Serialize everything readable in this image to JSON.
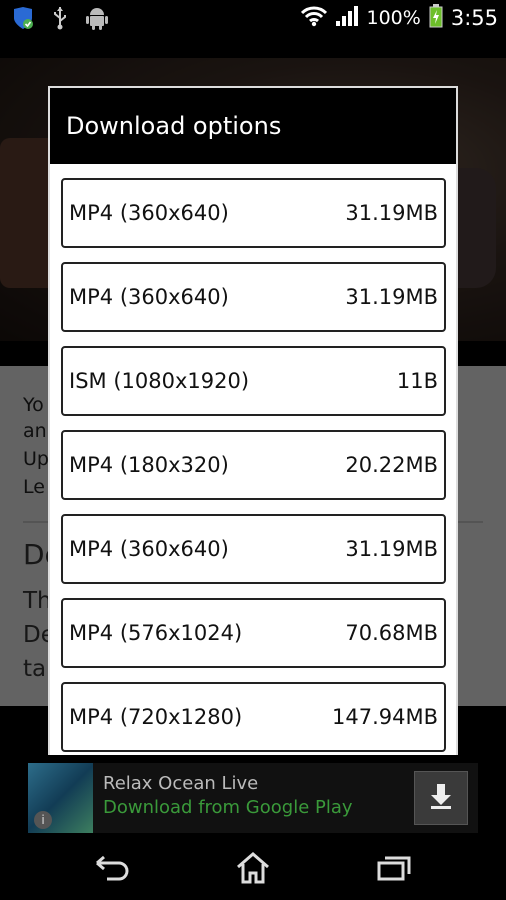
{
  "status_bar": {
    "battery_percent": "100%",
    "time": "3:55"
  },
  "background_page": {
    "text_lines": [
      "Yo",
      "an",
      "Up",
      "Le"
    ],
    "heading": "De",
    "body_lines": [
      "Th",
      "De",
      "tal"
    ]
  },
  "dialog": {
    "title": "Download options",
    "options": [
      {
        "format": "MP4 (360x640)",
        "size": "31.19MB"
      },
      {
        "format": "MP4 (360x640)",
        "size": "31.19MB"
      },
      {
        "format": "ISM (1080x1920)",
        "size": "11B"
      },
      {
        "format": "MP4 (180x320)",
        "size": "20.22MB"
      },
      {
        "format": "MP4 (360x640)",
        "size": "31.19MB"
      },
      {
        "format": "MP4 (576x1024)",
        "size": "70.68MB"
      },
      {
        "format": "MP4 (720x1280)",
        "size": "147.94MB"
      }
    ]
  },
  "ad": {
    "title": "Relax Ocean Live",
    "subtitle": "Download from Google Play",
    "info_glyph": "i"
  },
  "colors": {
    "ad_subtitle": "#3a9a3a",
    "dialog_header": "#000000"
  }
}
